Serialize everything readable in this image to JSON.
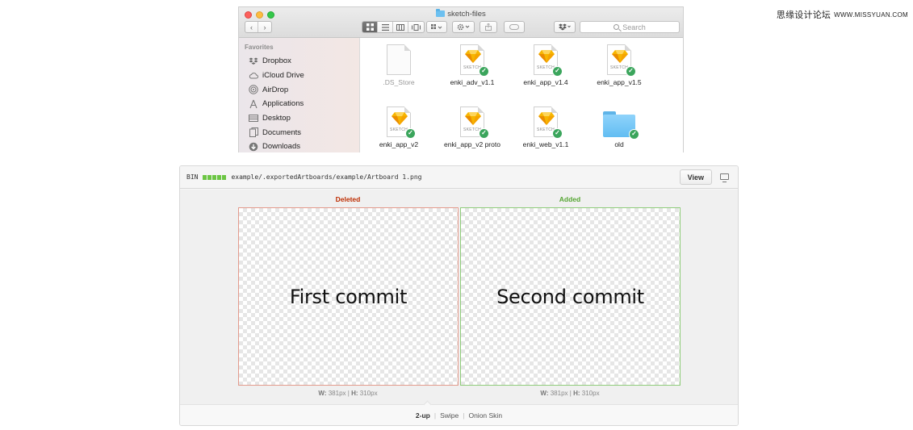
{
  "watermark": {
    "text": "思缘设计论坛",
    "url": "WWW.MISSYUAN.COM"
  },
  "finder": {
    "title": "sketch-files",
    "toolbar": {
      "back": "‹",
      "forward": "›",
      "search_placeholder": "Search"
    },
    "sidebar": {
      "heading": "Favorites",
      "items": [
        {
          "label": "Dropbox",
          "icon": "dropbox-icon"
        },
        {
          "label": "iCloud Drive",
          "icon": "cloud-icon"
        },
        {
          "label": "AirDrop",
          "icon": "airdrop-icon"
        },
        {
          "label": "Applications",
          "icon": "applications-icon"
        },
        {
          "label": "Desktop",
          "icon": "desktop-icon"
        },
        {
          "label": "Documents",
          "icon": "documents-icon"
        },
        {
          "label": "Downloads",
          "icon": "downloads-icon"
        }
      ]
    },
    "files": [
      {
        "name": ".DS_Store",
        "kind": "blank"
      },
      {
        "name": "enki_adv_v1.1",
        "kind": "sketch",
        "label": "SKETCH"
      },
      {
        "name": "enki_app_v1.4",
        "kind": "sketch",
        "label": "SKETCH"
      },
      {
        "name": "enki_app_v1.5",
        "kind": "sketch",
        "label": "SKETCH"
      },
      {
        "name": "enki_app_v2",
        "kind": "sketch",
        "label": "SKETCH"
      },
      {
        "name": "enki_app_v2 proto",
        "kind": "sketch",
        "label": "SKETCH"
      },
      {
        "name": "enki_web_v1.1",
        "kind": "sketch",
        "label": "SKETCH"
      },
      {
        "name": "old",
        "kind": "folder"
      }
    ]
  },
  "diff": {
    "bin_label": "BIN",
    "path": "example/.exportedArtboards/example/Artboard 1.png",
    "view_button": "View",
    "deleted_label": "Deleted",
    "added_label": "Added",
    "deleted_text": "First commit",
    "added_text": "Second commit",
    "deleted_dims": {
      "w_label": "W:",
      "w_value": "381px",
      "sep": "|",
      "h_label": "H:",
      "h_value": "310px"
    },
    "added_dims": {
      "w_label": "W:",
      "w_value": "381px",
      "sep": "|",
      "h_label": "H:",
      "h_value": "310px"
    },
    "modes": [
      "2-up",
      "Swipe",
      "Onion Skin"
    ],
    "active_mode": "2-up"
  },
  "colors": {
    "deleted": "#bd2c00",
    "added": "#55a532",
    "sketch_gem": "#f7b500",
    "check": "#3ba55c",
    "folder": "#62bdf2"
  }
}
